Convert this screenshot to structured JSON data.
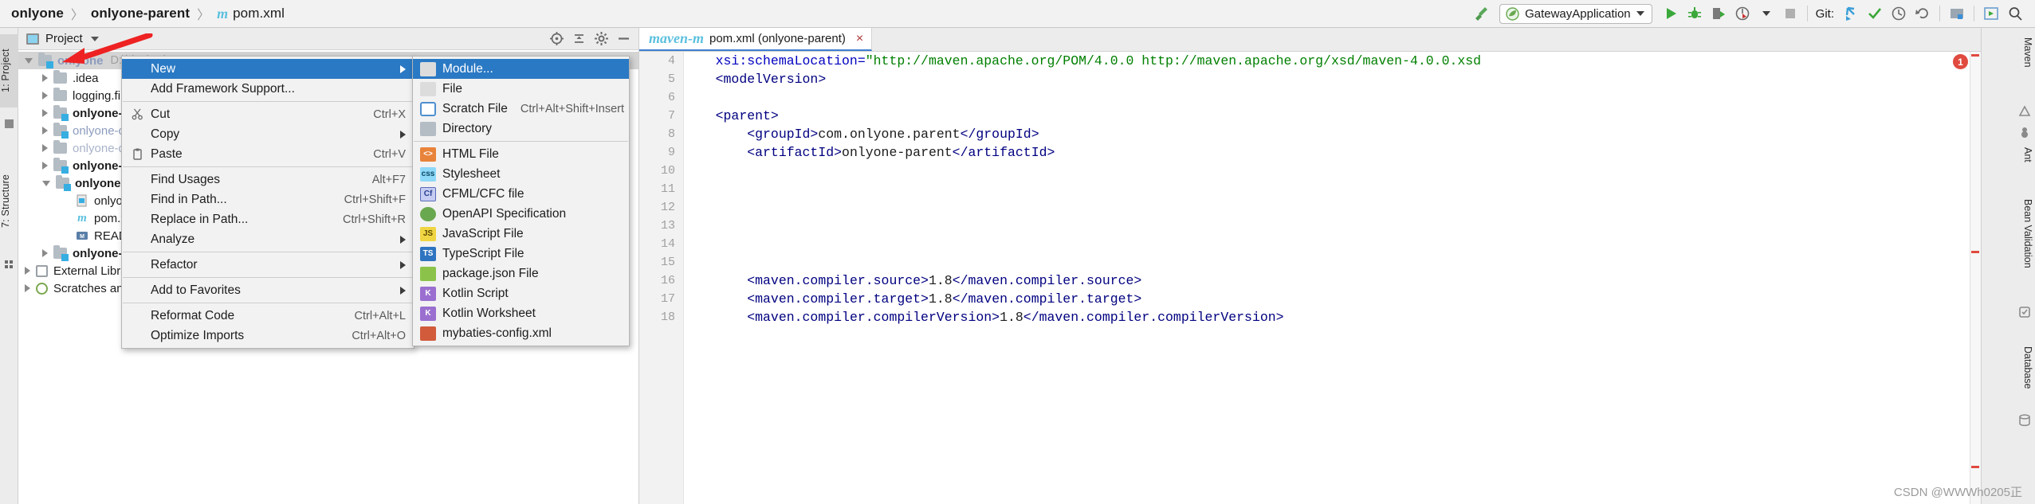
{
  "breadcrumb": {
    "items": [
      "onlyone",
      "onlyone-parent",
      "pom.xml"
    ],
    "separator": "〉",
    "maven_glyph": "m"
  },
  "toolbar": {
    "build_icon": "hammer-icon",
    "run_config": "GatewayApplication",
    "run_label": "Run",
    "debug_label": "Debug",
    "coverage_label": "Run with Coverage",
    "profile_label": "Profile",
    "stop_label": "Stop",
    "git_label": "Git:",
    "git_update_label": "Update Project",
    "git_commit_label": "Commit",
    "git_history_label": "History",
    "git_rollback_label": "Rollback",
    "search_label": "Search Everywhere"
  },
  "left_tool_window": {
    "tabs": [
      "1: Project",
      "7: Structure"
    ]
  },
  "right_tool_window": {
    "tabs": [
      "Maven",
      "Ant",
      "Bean Validation",
      "Database"
    ]
  },
  "project_panel": {
    "title": "Project",
    "header_buttons": [
      "locate-icon",
      "collapse-all-icon",
      "settings-icon",
      "hide-icon"
    ],
    "tree": [
      {
        "label": "onlyone",
        "path": "D:\\idea\\onlyone",
        "indent": 0,
        "expanded": true,
        "style": "root",
        "icon": "module-folder",
        "selected": true
      },
      {
        "label": ".idea",
        "indent": 1,
        "expanded": false,
        "style": "plain",
        "icon": "folder"
      },
      {
        "label": "logging.file.name_IS_UNDEFINED",
        "indent": 1,
        "expanded": false,
        "style": "plain",
        "icon": "folder"
      },
      {
        "label": "onlyone-common",
        "indent": 1,
        "expanded": false,
        "style": "bold",
        "icon": "module-folder"
      },
      {
        "label": "onlyone-config",
        "indent": 1,
        "expanded": false,
        "style": "muted",
        "icon": "module-folder"
      },
      {
        "label": "onlyone-doc",
        "indent": 1,
        "expanded": false,
        "style": "grey",
        "icon": "folder"
      },
      {
        "label": "onlyone-gateway",
        "indent": 1,
        "expanded": false,
        "style": "bold",
        "icon": "module-folder"
      },
      {
        "label": "onlyone-parent",
        "indent": 1,
        "expanded": true,
        "style": "bold",
        "icon": "module-folder"
      },
      {
        "label": "onlyone-parent.iml",
        "indent": 2,
        "style": "plain",
        "icon": "iml-file"
      },
      {
        "label": "pom.xml",
        "indent": 2,
        "style": "plain",
        "icon": "maven-file"
      },
      {
        "label": "README.md",
        "indent": 2,
        "style": "plain",
        "icon": "md-file"
      },
      {
        "label": "onlyone-registry",
        "indent": 1,
        "expanded": false,
        "style": "bold",
        "icon": "module-folder"
      },
      {
        "label": "External Libraries",
        "indent": 0,
        "expanded": false,
        "style": "plain",
        "icon": "library"
      },
      {
        "label": "Scratches and Consoles",
        "indent": 0,
        "expanded": false,
        "style": "plain",
        "icon": "scratch"
      }
    ]
  },
  "context_menu": {
    "items": [
      {
        "label": "New",
        "icon": "",
        "accel": "",
        "submenu": true,
        "selected": true
      },
      {
        "label": "Add Framework Support...",
        "icon": "",
        "accel": ""
      },
      {
        "separator": true
      },
      {
        "label": "Cut",
        "icon": "scissors-icon",
        "accel": "Ctrl+X"
      },
      {
        "label": "Copy",
        "icon": "",
        "accel": "",
        "submenu": true
      },
      {
        "label": "Paste",
        "icon": "clipboard-icon",
        "accel": "Ctrl+V"
      },
      {
        "separator": true
      },
      {
        "label": "Find Usages",
        "icon": "",
        "accel": "Alt+F7"
      },
      {
        "label": "Find in Path...",
        "icon": "",
        "accel": "Ctrl+Shift+F"
      },
      {
        "label": "Replace in Path...",
        "icon": "",
        "accel": "Ctrl+Shift+R"
      },
      {
        "label": "Analyze",
        "icon": "",
        "accel": "",
        "submenu": true
      },
      {
        "separator": true
      },
      {
        "label": "Refactor",
        "icon": "",
        "accel": "",
        "submenu": true
      },
      {
        "separator": true
      },
      {
        "label": "Add to Favorites",
        "icon": "",
        "accel": "",
        "submenu": true
      },
      {
        "separator": true
      },
      {
        "label": "Reformat Code",
        "icon": "",
        "accel": "Ctrl+Alt+L"
      },
      {
        "label": "Optimize Imports",
        "icon": "",
        "accel": "Ctrl+Alt+O"
      }
    ]
  },
  "new_submenu": {
    "items": [
      {
        "label": "Module...",
        "icon": "module-icon",
        "accel": "",
        "selected": true
      },
      {
        "label": "File",
        "icon": "file-icon",
        "accel": ""
      },
      {
        "label": "Scratch File",
        "icon": "scratch-file-icon",
        "accel": "Ctrl+Alt+Shift+Insert"
      },
      {
        "label": "Directory",
        "icon": "directory-icon",
        "accel": ""
      },
      {
        "separator": true
      },
      {
        "label": "HTML File",
        "icon": "html-icon",
        "accel": ""
      },
      {
        "label": "Stylesheet",
        "icon": "css-icon",
        "accel": ""
      },
      {
        "label": "CFML/CFC file",
        "icon": "cfml-icon",
        "accel": ""
      },
      {
        "label": "OpenAPI Specification",
        "icon": "openapi-icon",
        "accel": ""
      },
      {
        "label": "JavaScript File",
        "icon": "js-icon",
        "accel": ""
      },
      {
        "label": "TypeScript File",
        "icon": "ts-icon",
        "accel": ""
      },
      {
        "label": "package.json File",
        "icon": "package-icon",
        "accel": ""
      },
      {
        "label": "Kotlin Script",
        "icon": "kotlin-icon",
        "accel": ""
      },
      {
        "label": "Kotlin Worksheet",
        "icon": "kotlin-icon",
        "accel": ""
      },
      {
        "label": "mybaties-config.xml",
        "icon": "mybatis-icon",
        "accel": ""
      }
    ]
  },
  "editor": {
    "tab_label": "pom.xml (onlyone-parent)",
    "tab_icon": "maven-m",
    "tab_close": "×",
    "error_count": "1",
    "visible_line_number": "4",
    "lines": [
      {
        "num": "4",
        "segments": [
          {
            "t": "    ",
            "c": "txt"
          },
          {
            "t": "xsi:schemaLocation=",
            "c": "attr"
          },
          {
            "t": "\"http://maven.apache.org/POM/4.0.0 http://maven.apache.org/xsd/maven-4.0.0.xsd",
            "c": "val"
          }
        ]
      },
      {
        "num": "5",
        "segments": [
          {
            "t": "    ",
            "c": "txt"
          },
          {
            "t": "<modelVersion>",
            "c": "tag"
          }
        ]
      },
      {
        "num": "6",
        "segments": []
      },
      {
        "num": "7",
        "segments": [
          {
            "t": "    ",
            "c": "txt"
          },
          {
            "t": "<parent>",
            "c": "tag"
          }
        ]
      },
      {
        "num": "8",
        "segments": [
          {
            "t": "        ",
            "c": "txt"
          },
          {
            "t": "<groupId>",
            "c": "tag"
          },
          {
            "t": "com.onlyone.parent",
            "c": "txt"
          },
          {
            "t": "</groupId>",
            "c": "tag"
          }
        ]
      },
      {
        "num": "9",
        "segments": [
          {
            "t": "        ",
            "c": "txt"
          },
          {
            "t": "<artifactId>",
            "c": "tag"
          },
          {
            "t": "onlyone-parent",
            "c": "txt"
          },
          {
            "t": "</artifactId>",
            "c": "tag"
          }
        ]
      },
      {
        "num": "10",
        "segments": []
      },
      {
        "num": "11",
        "segments": []
      },
      {
        "num": "12",
        "segments": []
      },
      {
        "num": "13",
        "segments": []
      },
      {
        "num": "14",
        "segments": []
      },
      {
        "num": "15",
        "segments": []
      },
      {
        "num": "16",
        "segments": [
          {
            "t": "        ",
            "c": "txt"
          },
          {
            "t": "<maven.compiler.source>",
            "c": "tag"
          },
          {
            "t": "1.8",
            "c": "txt"
          },
          {
            "t": "</maven.compiler.source>",
            "c": "tag"
          }
        ]
      },
      {
        "num": "17",
        "segments": [
          {
            "t": "        ",
            "c": "txt"
          },
          {
            "t": "<maven.compiler.target>",
            "c": "tag"
          },
          {
            "t": "1.8",
            "c": "txt"
          },
          {
            "t": "</maven.compiler.target>",
            "c": "tag"
          }
        ]
      },
      {
        "num": "18",
        "segments": [
          {
            "t": "        ",
            "c": "txt"
          },
          {
            "t": "<maven.compiler.compilerVersion>",
            "c": "tag"
          },
          {
            "t": "1.8",
            "c": "txt"
          },
          {
            "t": "</maven.compiler.compilerVersion>",
            "c": "tag"
          }
        ]
      }
    ]
  },
  "watermark": "CSDN @WWWh0205正",
  "colors": {
    "accent": "#2a79c4",
    "selection": "#d4d4d4",
    "error": "#e04a3f",
    "module_badge": "#37aee2",
    "annotation_arrow": "#ee2222"
  }
}
